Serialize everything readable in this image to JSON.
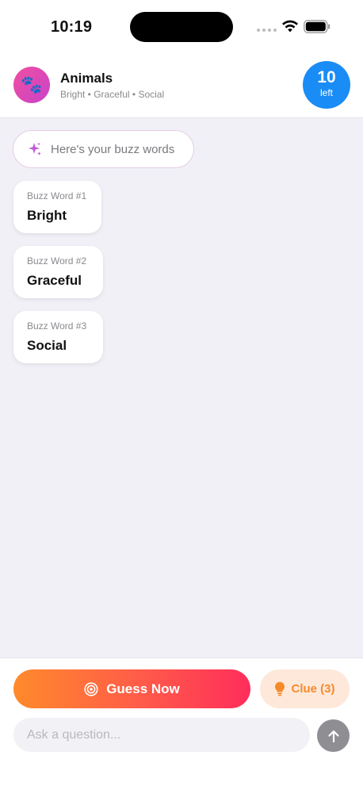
{
  "status_bar": {
    "time": "10:19"
  },
  "header": {
    "avatar_emoji": "🐾",
    "title": "Animals",
    "subtitle": "Bright • Graceful • Social",
    "counter": {
      "number": "10",
      "label": "left"
    }
  },
  "chat": {
    "banner_text": "Here's your buzz words",
    "cards": [
      {
        "label": "Buzz Word #1",
        "word": "Bright"
      },
      {
        "label": "Buzz Word #2",
        "word": "Graceful"
      },
      {
        "label": "Buzz Word #3",
        "word": "Social"
      }
    ]
  },
  "bottom_bar": {
    "guess_label": "Guess Now",
    "clue_label": "Clue (3)",
    "input_placeholder": "Ask a question..."
  },
  "colors": {
    "accent_blue": "#1a8cf5",
    "guess_gradient_start": "#ff8a2b",
    "guess_gradient_end": "#ff2d5a",
    "clue_text": "#f58a2a",
    "clue_bg": "#fde8da",
    "avatar_gradient": "#f04fa0",
    "sparkle": "#c05ad8"
  },
  "icons": {
    "wifi": "wifi-icon",
    "battery": "battery-icon",
    "sparkle": "sparkle-icon",
    "target": "target-icon",
    "bulb": "bulb-icon",
    "send": "arrow-up-icon"
  }
}
